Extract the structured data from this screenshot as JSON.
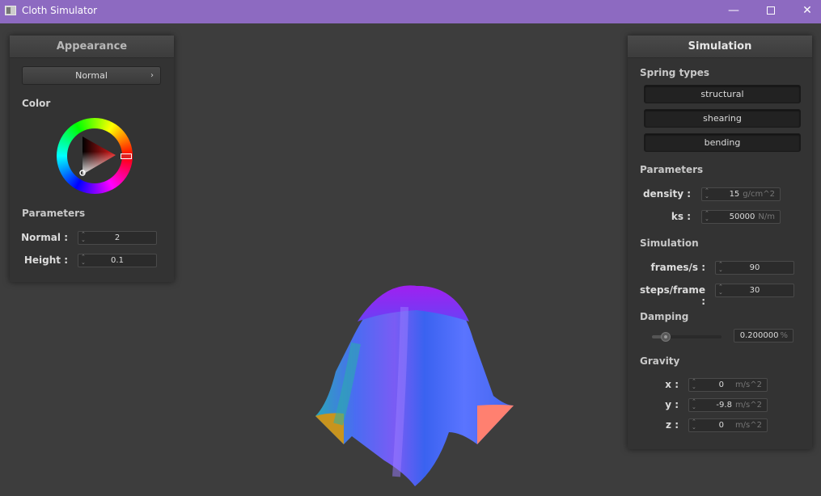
{
  "window": {
    "title": "Cloth Simulator",
    "controls": {
      "minimize": "—",
      "close": "✕"
    },
    "icons": {
      "app": "app-window-icon",
      "minimize": "minimize-icon",
      "maximize": "maximize-icon",
      "close": "close-icon"
    }
  },
  "appearance": {
    "header": "Appearance",
    "shader": {
      "selected": "Normal",
      "chevron": "›"
    },
    "color_label": "Color",
    "color_value": "#e02020",
    "params_label": "Parameters",
    "normal": {
      "label": "Normal :",
      "value": "2"
    },
    "height": {
      "label": "Height :",
      "value": "0.1"
    }
  },
  "simulation": {
    "header": "Simulation",
    "spring_types_label": "Spring types",
    "spring_types": [
      "structural",
      "shearing",
      "bending"
    ],
    "params_label": "Parameters",
    "density": {
      "label": "density :",
      "value": "15",
      "unit": "g/cm^2"
    },
    "ks": {
      "label": "ks :",
      "value": "50000",
      "unit": "N/m"
    },
    "sim_label": "Simulation",
    "fps": {
      "label": "frames/s :",
      "value": "90"
    },
    "steps": {
      "label": "steps/frame :",
      "value": "30"
    },
    "damping_label": "Damping",
    "damping": {
      "value": "0.200000",
      "unit": "%",
      "fraction": 0.2
    },
    "gravity_label": "Gravity",
    "gx": {
      "label": "x :",
      "value": "0",
      "unit": "m/s^2"
    },
    "gy": {
      "label": "y :",
      "value": "-9.8",
      "unit": "m/s^2"
    },
    "gz": {
      "label": "z :",
      "value": "0",
      "unit": "m/s^2"
    }
  },
  "spinner_arrows": {
    "up": "⌃",
    "down": "⌄"
  }
}
